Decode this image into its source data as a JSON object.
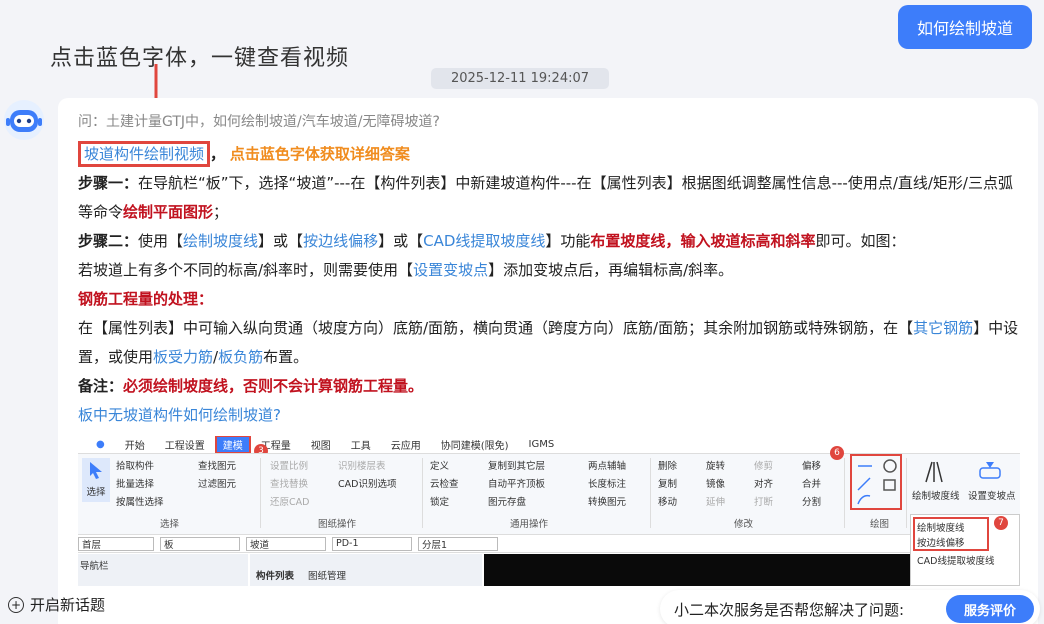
{
  "user_message": "如何绘制坡道",
  "annotation": "点击蓝色字体，一键查看视频",
  "timestamp": "2025-12-11 19:24:07",
  "question": "问：土建计量GTJ中，如何绘制坡道/汽车坡道/无障碍坡道?",
  "answer": {
    "video_link": "坡道构件绘制视频",
    "video_comma": "，",
    "video_hint": "点击蓝色字体获取详细答案",
    "step1_label": "步骤一：",
    "step1_text": "在导航栏“板”下，选择“坡道”---在【构件列表】中新建坡道构件---在【属性列表】根据图纸调整属性信息---使用点/直线/矩形/三点弧等命令",
    "step1_bold": "绘制平面图形",
    "step1_end": "；",
    "step2_label": "步骤二：",
    "step2_a": "使用【",
    "step2_link1": "绘制坡度线",
    "step2_b": "】或【",
    "step2_link2": "按边线偏移",
    "step2_c": "】或【",
    "step2_link3": "CAD线提取坡度线",
    "step2_d": "】功能",
    "step2_bold1": "布置坡度线",
    "step2_e": "，",
    "step2_bold2": "输入坡道标高和斜率",
    "step2_f": "即可。如图：",
    "step2_g": "若坡道上有多个不同的标高/斜率时，则需要使用【",
    "step2_link4": "设置变坡点",
    "step2_h": "】添加变坡点后，再编辑标高/斜率。",
    "rebar_title": "钢筋工程量的处理：",
    "rebar_a": "在【属性列表】中可输入纵向贯通（坡度方向）底筋/面筋，横向贯通（跨度方向）底筋/面筋；其余附加钢筋或特殊钢筋，在【",
    "rebar_link1": "其它钢筋",
    "rebar_b": "】中设置，或使用",
    "rebar_link2": "板受力筋",
    "rebar_c": "/",
    "rebar_link3": "板负筋",
    "rebar_d": "布置。",
    "note_label": "备注：",
    "note_bold": "必须绘制坡度线，否则不会计算钢筋工程量。",
    "final_link": "板中无坡道构件如何绘制坡道?"
  },
  "cad": {
    "tabs": [
      "开始",
      "工程设置",
      "建模",
      "工程量",
      "视图",
      "工具",
      "云应用",
      "协同建模(限免)",
      "IGMS"
    ],
    "select_group": {
      "select": "选择",
      "pick": "拾取构件",
      "batch": "批量选择",
      "byattr": "按属性选择",
      "find": "查找图元",
      "filter": "过滤图元",
      "section": "选择"
    },
    "drawing_group": {
      "scale": "设置比例",
      "layers": "识别楼层表",
      "replace": "查找替换",
      "cad_options": "CAD识别选项",
      "restore": "还原CAD",
      "section": "图纸操作"
    },
    "common_group": {
      "define": "定义",
      "copy_to": "复制到其它层",
      "two_point": "两点辅轴",
      "cloud": "云检查",
      "auto_level": "自动平齐顶板",
      "length": "长度标注",
      "lock": "锁定",
      "store": "图元存盘",
      "convert": "转换图元",
      "section": "通用操作"
    },
    "modify_group": {
      "delete": "删除",
      "rotate": "旋转",
      "trim": "修剪",
      "offset": "偏移",
      "copy": "复制",
      "mirror": "镜像",
      "align": "对齐",
      "merge": "合并",
      "move": "移动",
      "extend": "延伸",
      "break": "打断",
      "split": "分割",
      "section": "修改"
    },
    "draw_group": {
      "section": "绘图"
    },
    "slope_group": {
      "draw_slope": "绘制坡度线",
      "set_point": "设置变坡点"
    },
    "props": {
      "floor": "首层",
      "type": "板",
      "sub": "坡道",
      "pd": "PD-1",
      "layer": "分层1"
    },
    "nav": "导航栏",
    "list_tabs": [
      "构件列表",
      "图纸管理"
    ],
    "dropdown": [
      "绘制坡度线",
      "按边线偏移",
      "CAD线提取坡度线"
    ],
    "badges": [
      "3",
      "6",
      "7"
    ]
  },
  "bottom": {
    "new_topic": "开启新话题",
    "feedback_q": "小二本次服务是否帮您解决了问题:",
    "feedback_btn": "服务评价"
  },
  "colors": {
    "accent": "#3d7dfa",
    "link": "#3a86d8",
    "red": "#c1121f",
    "orange": "#f08c1e",
    "annot_red": "#e0463e"
  }
}
